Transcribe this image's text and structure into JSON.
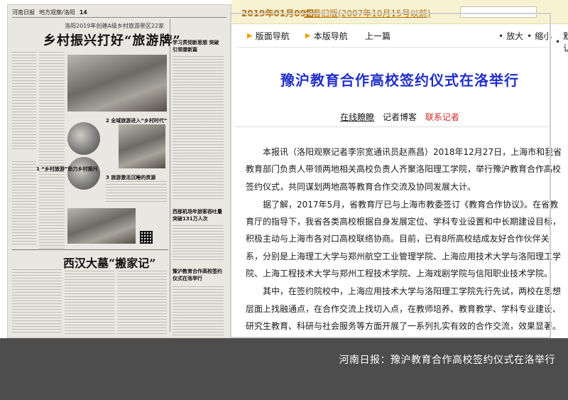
{
  "paper": {
    "header": {
      "masthead": "河南日报",
      "section": "地方观察/洛阳",
      "page_no": "14"
    },
    "kicker": "洛阳2019年创建A级乡村旅游景区22家",
    "headline": "乡村振兴打好“旅游牌”",
    "sub1": "2 全域旅游进入“乡村时代”",
    "sub2": "3 旅游激活沉睡的资源",
    "sub3": "1 “乡村旅游”助力乡村振兴",
    "side1": "学习贯彻新思想 突破引领谱新篇",
    "side2": "西部机场年旅客吞吐量突破131万人次",
    "headline2": "西汉大墓“搬家记”",
    "side3": "豫沪教育合作高校签约仪式在洛举行"
  },
  "datebar": {
    "date": "2019年01月09日",
    "archive_link": "查看旧版(2007年10月15号以前)",
    "search_value": ""
  },
  "nav": {
    "layout_nav": "版面导航",
    "page_nav": "本版导航",
    "prev": "上一篇",
    "zoom_in": "放大",
    "zoom_out": "缩小",
    "default": "默认"
  },
  "article": {
    "title": "豫沪教育合作高校签约仪式在洛举行",
    "byline": {
      "online": "在线瞭瞭",
      "blog": "记者博客",
      "contact": "联系记者"
    },
    "paragraphs": [
      "本报讯（洛阳观察记者李宗宽通讯员赵燕昌）2018年12月27日，上海市和我省教育部门负责人带领两地相关高校负责人齐聚洛阳理工学院，举行豫沪教育合作高校签约仪式，共同谋划两地高等教育合作交流及协同发展大计。",
      "据了解，2017年5月，省教育厅已与上海市教委签订《教育合作协议》。在省教育厅的指导下，我省各类高校根据自身发展定位、学科专业设置和中长期建设目标，积极主动与上海市各对口高校联络协商。目前，已有8所高校结成友好合作伙伴关系，分别是上海理工大学与郑州航空工业管理学院、上海应用技术大学与洛阳理工学院、上海工程技术大学与郑州工程技术学院、上海戏剧学院与信阳职业技术学院。",
      "其中，在签约院校中，上海应用技术大学与洛阳理工学院先行先试，两校在思想层面上找融通点，在合作交流上找切入点，在教师培养、教育教学、学科专业建设、研究生教育、科研与社会服务等方面开展了一系列扎实有效的合作交流，效果显著。"
    ]
  },
  "caption": "河南日报：豫沪教育合作高校签约仪式在洛举行",
  "colors": {
    "title_blue": "#2230c8",
    "date_orange": "#b56a0a",
    "contact_red": "#d12b2b",
    "caption_bg": "#4d4d4d"
  }
}
